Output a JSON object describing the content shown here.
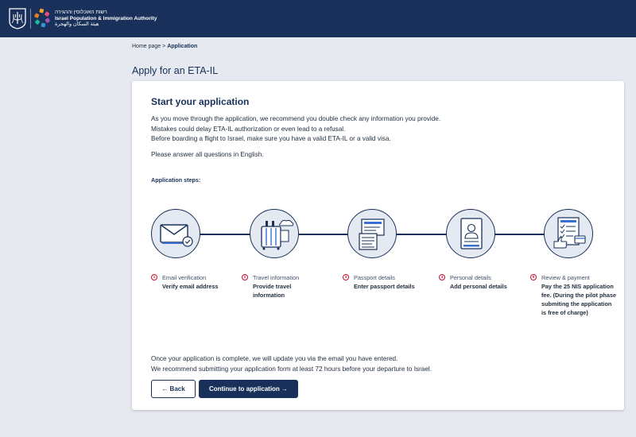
{
  "header": {
    "org_hebrew": "רשות האוכלוסין וההגירה",
    "org_english": "Israel Population & Immigration Authority",
    "org_arabic": "هيئة السكان والهجرة"
  },
  "breadcrumb": {
    "home": "Home page",
    "separator": " > ",
    "current": "Application"
  },
  "page_title": "Apply for an ETA-IL",
  "card": {
    "title": "Start your application",
    "intro": [
      "As you move through the application, we recommend you double check any information you provide.",
      "Mistakes could delay ETA-IL authorization or even lead to a refusal.",
      "Before boarding a flight to Israel, make sure you have a valid ETA-IL or a valid visa."
    ],
    "english_note": "Please answer all questions in English.",
    "steps_heading": "Application steps:",
    "steps": [
      {
        "number": "1",
        "name": "Email verification",
        "action": "Verify email address",
        "icon": "envelope-check-icon"
      },
      {
        "number": "2",
        "name": "Travel information",
        "action": "Provide travel information",
        "icon": "luggage-icon"
      },
      {
        "number": "3",
        "name": "Passport details",
        "action": "Enter passport details",
        "icon": "passport-icon"
      },
      {
        "number": "4",
        "name": "Personal details",
        "action": "Add personal details",
        "icon": "id-card-icon"
      },
      {
        "number": "5",
        "name": "Review & payment",
        "action": "Pay the 25 NIS application fee. (During the pilot phase submiting the application is free of charge)",
        "icon": "checklist-payment-icon"
      }
    ],
    "outro": [
      "Once your application is complete, we will update you via the email you have entered.",
      "We recommend submitting your application form at least 72 hours before your departure to Israel."
    ],
    "back_label": "← Back",
    "continue_label": "Continue to application →"
  },
  "colors": {
    "navy": "#18305a",
    "accent_red": "#c8102e",
    "background": "#e6e9ef",
    "icon_blue": "#3b6fd1"
  }
}
